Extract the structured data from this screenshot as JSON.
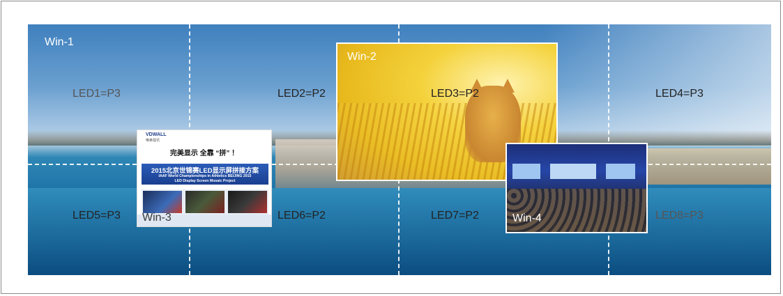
{
  "leds": [
    {
      "label": "LED1=P3"
    },
    {
      "label": "LED2=P2"
    },
    {
      "label": "LED3=P2"
    },
    {
      "label": "LED4=P3"
    },
    {
      "label": "LED5=P3"
    },
    {
      "label": "LED6=P2"
    },
    {
      "label": "LED7=P2"
    },
    {
      "label": "LED8=P3"
    }
  ],
  "windows": [
    {
      "label": "Win-1"
    },
    {
      "label": "Win-2"
    },
    {
      "label": "Win-3"
    },
    {
      "label": "Win-4"
    }
  ],
  "win3_content": {
    "logo": "VDWALL",
    "logo_sub": "唯奥视讯",
    "slogan": "完美显示 全靠 “拼” ！",
    "banner_line1": "2015北京世锦赛LED显示屏拼接方案",
    "banner_line2": "IAAF World Championships in Athletics BEIJING 2015",
    "banner_line3": "LED Display Screen  Mosaic Project"
  }
}
